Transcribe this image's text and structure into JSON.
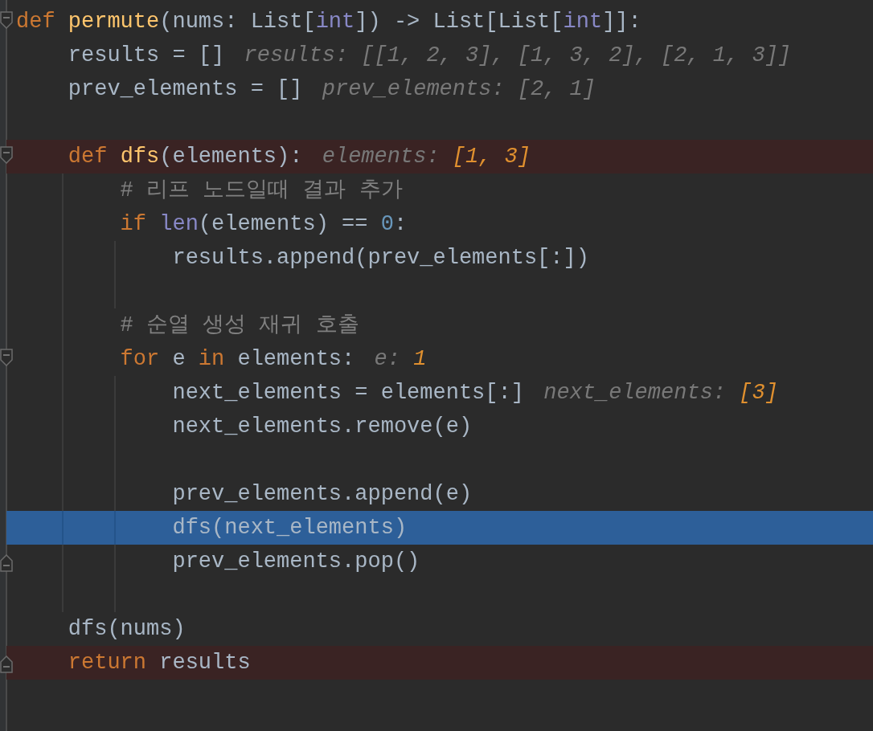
{
  "editor": {
    "lines": [
      {
        "fold_start": true,
        "tokens": [
          {
            "kind": "keyword",
            "text": "def "
          },
          {
            "kind": "function",
            "text": "permute"
          },
          {
            "kind": "plain",
            "text": "(nums: List["
          },
          {
            "kind": "builtin",
            "text": "int"
          },
          {
            "kind": "plain",
            "text": "]) -> List[List["
          },
          {
            "kind": "builtin",
            "text": "int"
          },
          {
            "kind": "plain",
            "text": "]]:"
          }
        ]
      },
      {
        "tokens": [
          {
            "kind": "plain",
            "text": "    results = []"
          }
        ],
        "hint": [
          {
            "kind": "label",
            "text": "results: [[1, 2, 3], [1, 3, 2], [2, 1, 3]]"
          }
        ]
      },
      {
        "blank_after": true,
        "tokens": [
          {
            "kind": "plain",
            "text": "    prev_elements = []"
          }
        ],
        "hint": [
          {
            "kind": "label",
            "text": "prev_elements: [2, 1]"
          }
        ]
      },
      {
        "fold_start": true,
        "breakpoint": true,
        "tokens": [
          {
            "kind": "keyword",
            "text": "    def "
          },
          {
            "kind": "function",
            "text": "dfs"
          },
          {
            "kind": "plain",
            "text": "(elements):"
          }
        ],
        "hint": [
          {
            "kind": "label",
            "text": "elements: "
          },
          {
            "kind": "changed",
            "text": "[1, 3]"
          }
        ]
      },
      {
        "tokens": [
          {
            "kind": "comment",
            "text": "        # 리프 노드일때 결과 추가"
          }
        ]
      },
      {
        "tokens": [
          {
            "kind": "keyword",
            "text": "        if "
          },
          {
            "kind": "builtin",
            "text": "len"
          },
          {
            "kind": "plain",
            "text": "(elements) == "
          },
          {
            "kind": "number",
            "text": "0"
          },
          {
            "kind": "plain",
            "text": ":"
          }
        ]
      },
      {
        "blank_after": true,
        "tokens": [
          {
            "kind": "plain",
            "text": "            results.append(prev_elements[:])"
          }
        ]
      },
      {
        "tokens": [
          {
            "kind": "comment",
            "text": "        # 순열 생성 재귀 호출"
          }
        ]
      },
      {
        "fold_start": true,
        "tokens": [
          {
            "kind": "keyword",
            "text": "        for "
          },
          {
            "kind": "plain",
            "text": "e "
          },
          {
            "kind": "keyword",
            "text": "in "
          },
          {
            "kind": "plain",
            "text": "elements:"
          }
        ],
        "hint": [
          {
            "kind": "label",
            "text": "e: "
          },
          {
            "kind": "changed",
            "text": "1"
          }
        ]
      },
      {
        "tokens": [
          {
            "kind": "plain",
            "text": "            next_elements = elements[:]"
          }
        ],
        "hint": [
          {
            "kind": "label",
            "text": "next_elements: "
          },
          {
            "kind": "changed",
            "text": "[3]"
          }
        ]
      },
      {
        "blank_after": true,
        "tokens": [
          {
            "kind": "plain",
            "text": "            next_elements.remove(e)"
          }
        ]
      },
      {
        "tokens": [
          {
            "kind": "plain",
            "text": "            prev_elements.append(e)"
          }
        ]
      },
      {
        "current": true,
        "tokens": [
          {
            "kind": "plain",
            "text": "            dfs(next_elements)"
          }
        ]
      },
      {
        "fold_end": true,
        "blank_after": true,
        "tokens": [
          {
            "kind": "plain",
            "text": "            prev_elements.pop()"
          }
        ]
      },
      {
        "tokens": [
          {
            "kind": "plain",
            "text": "    dfs(nums)"
          }
        ]
      },
      {
        "fold_end": true,
        "breakpoint": true,
        "tokens": [
          {
            "kind": "keyword",
            "text": "    return "
          },
          {
            "kind": "plain",
            "text": "results"
          }
        ]
      }
    ]
  }
}
